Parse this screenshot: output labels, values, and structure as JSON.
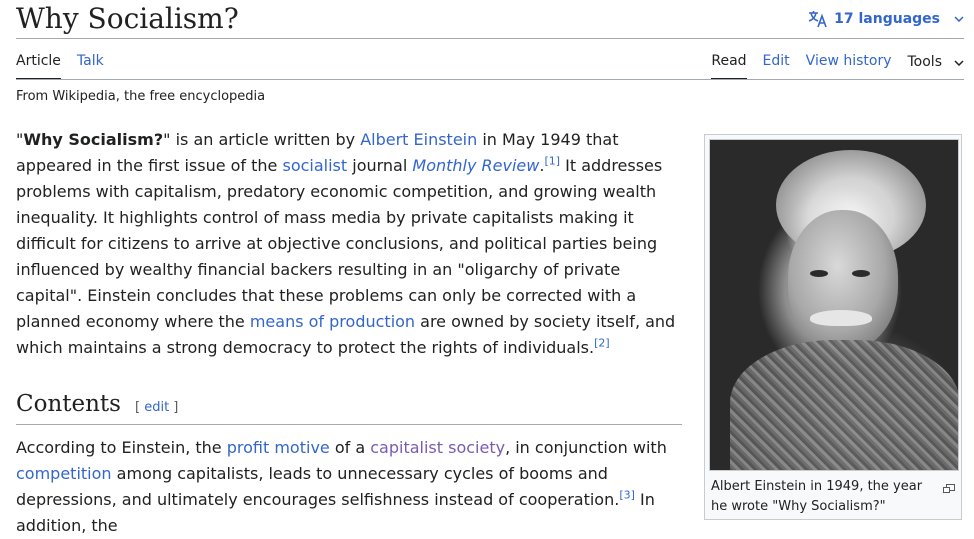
{
  "page": {
    "title": "Why Socialism?",
    "languages_label": "17 languages",
    "tagline": "From Wikipedia, the free encyclopedia"
  },
  "tabs_left": [
    {
      "label": "Article",
      "active": true
    },
    {
      "label": "Talk",
      "active": false
    }
  ],
  "tabs_right": [
    {
      "label": "Read",
      "active": true
    },
    {
      "label": "Edit",
      "active": false
    },
    {
      "label": "View history",
      "active": false
    },
    {
      "label": "Tools",
      "active": false
    }
  ],
  "lead": {
    "q_open": "\"",
    "bold_title": "Why Socialism?",
    "t1": "\" is an article written by ",
    "link_einstein": "Albert Einstein",
    "t2": " in May 1949 that appeared in the first issue of the ",
    "link_socialist": "socialist",
    "t3": " journal ",
    "link_monthly": "Monthly Review",
    "t4": ".",
    "ref1": "[1]",
    "t5": " It addresses problems with capitalism, predatory economic competition, and growing wealth inequality. It highlights control of mass media by private capitalists making it difficult for citizens to arrive at objective conclusions, and political parties being influenced by wealthy financial backers resulting in an \"oligarchy of private capital\". Einstein concludes that these problems can only be corrected with a planned economy where the ",
    "link_means": "means of production",
    "t6": " are owned by society itself, and which maintains a strong democracy to protect the rights of individuals.",
    "ref2": "[2]"
  },
  "section": {
    "heading": "Contents",
    "edit_open": "[ ",
    "edit_label": "edit",
    "edit_close": " ]",
    "t1": "According to Einstein, the ",
    "link_profit": "profit motive",
    "t2": " of a ",
    "link_capsoc": "capitalist society",
    "t3": ", in conjunction with ",
    "link_competition": "competition",
    "t4": " among capitalists, leads to unnecessary cycles of booms and depressions, and ultimately encourages selfishness instead of cooperation.",
    "ref3": "[3]",
    "t5": " In addition, the"
  },
  "infobox": {
    "caption": "Albert Einstein in 1949, the year he wrote \"Why Socialism?\""
  },
  "icons": {
    "translate": "translate-icon",
    "chevron": "chevron-down-icon",
    "enlarge": "enlarge-icon"
  },
  "colors": {
    "link": "#3366cc",
    "visited_link": "#795cb2",
    "text": "#202122",
    "rule": "#a2a9b1"
  }
}
